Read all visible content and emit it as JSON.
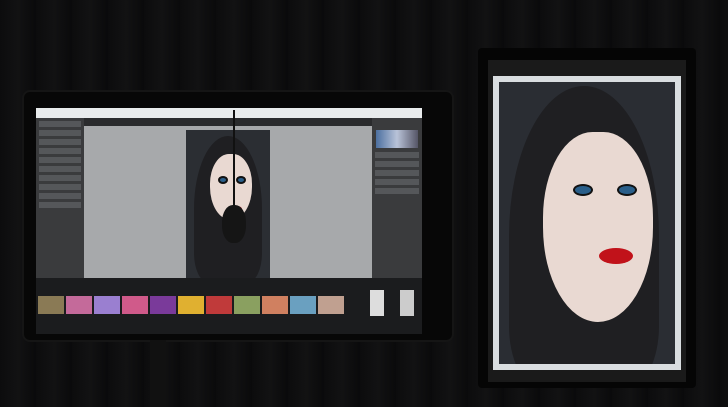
{
  "scene": {
    "description_colors": {
      "background": "#0b0b0c",
      "lips": "#c1121a",
      "eyes": "#2a5f8a",
      "ui_panel": "#3a3b3d"
    }
  }
}
